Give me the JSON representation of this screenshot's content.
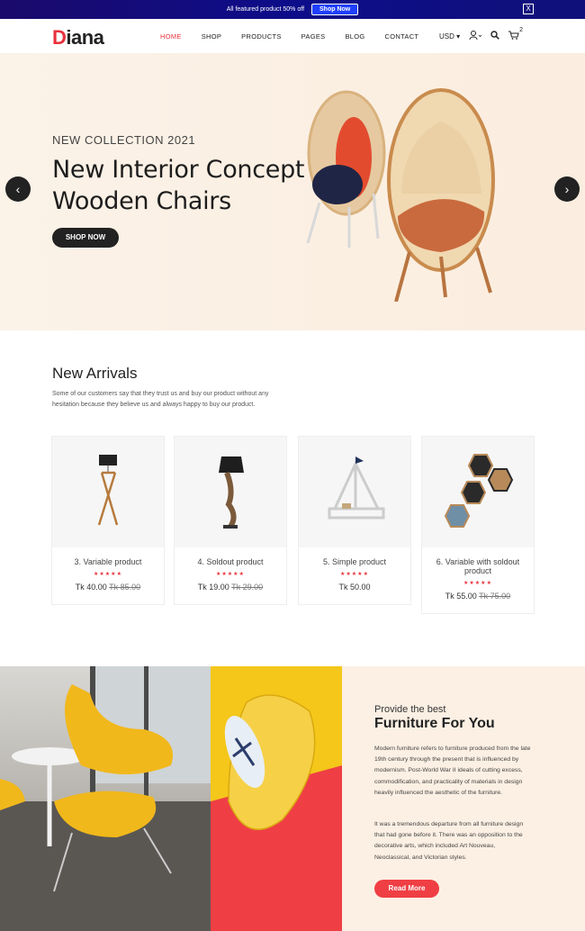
{
  "topbar": {
    "text": "All featured product 50% off",
    "button": "Shop Now",
    "close": "X"
  },
  "logo": {
    "first": "D",
    "rest": "iana"
  },
  "nav": {
    "items": [
      "HOME",
      "SHOP",
      "PRODUCTS",
      "PAGES",
      "BLOG",
      "CONTACT"
    ],
    "active": "HOME"
  },
  "header_icons": {
    "currency": "USD",
    "cart_count": "2"
  },
  "hero": {
    "subtitle": "NEW COLLECTION 2021",
    "title_line1": "New Interior Concept",
    "title_line2": "Wooden Chairs",
    "button": "SHOP NOW",
    "prev": "‹",
    "next": "›"
  },
  "arrivals": {
    "title": "New Arrivals",
    "description": "Some of our customers say that they trust us and buy our product without any hesitation because they believe us and always happy to buy our product."
  },
  "products": [
    {
      "name": "3. Variable product",
      "price": "Tk 40.00",
      "old_price": "Tk 85.00",
      "stars": "★★★★★"
    },
    {
      "name": "4. Soldout product",
      "price": "Tk 19.00",
      "old_price": "Tk 29.00",
      "stars": "★★★★★"
    },
    {
      "name": "5. Simple product",
      "price": "Tk 50.00",
      "old_price": "",
      "stars": "★★★★★"
    },
    {
      "name": "6. Variable with soldout product",
      "price": "Tk 55.00",
      "old_price": "Tk 75.00",
      "stars": "★★★★★"
    }
  ],
  "feature": {
    "pre": "Provide the best",
    "title": "Furniture For You",
    "p1": "Modern furniture refers to furniture produced from the late 19th century through the present that is influenced by modernism. Post-World War II ideals of cutting excess, commodification, and practicality of materials in design heavily influenced the aesthetic of the furniture.",
    "p2": "It was a tremendous departure from all furniture design that had gone before it. There was an opposition to the decorative arts, which included Art Nouveau, Neoclassical, and Victorian styles.",
    "button": "Read More"
  },
  "colors": {
    "accent": "#e8313d",
    "topbar": "#0d0d8a",
    "hero_bg": "#fbf0e4",
    "dark": "#222222"
  }
}
